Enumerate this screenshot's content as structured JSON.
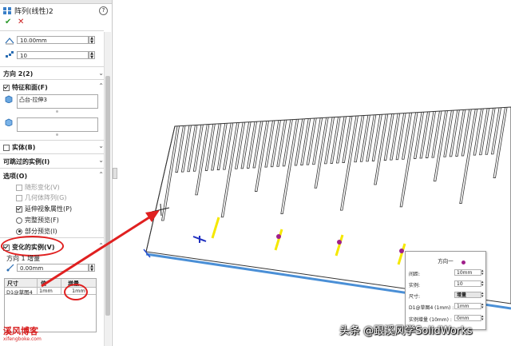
{
  "panel": {
    "title": "阵列(线性)2",
    "ok_symbol": "✔",
    "cancel_symbol": "✕",
    "help_symbol": "?",
    "spacing_value": "10.00mm",
    "instances_value": "10",
    "direction2_header": "方向 2(2)",
    "features_header": "特征和面(F)",
    "feature_item": "凸台-拉伸3",
    "bodies_header": "实体(B)",
    "skip_header": "可跳过的实例(I)",
    "options_header": "选项(O)",
    "opt_vary_sketch": "随形变化(V)",
    "opt_geometry_pattern": "几何体阵列(G)",
    "opt_propagate_visual": "延伸视象属性(P)",
    "opt_full_preview": "完整预览(F)",
    "opt_partial_preview": "部分预览(I)",
    "varying_header": "变化的实例(V)",
    "direction1_increment": "方向 1 增量",
    "increment_value": "0.00mm",
    "table": {
      "headers": [
        "尺寸",
        "值",
        "增量"
      ],
      "rows": [
        [
          "D1@草图4",
          "1mm",
          "1mm"
        ]
      ]
    }
  },
  "popup": {
    "title": "方向一",
    "rows": [
      {
        "label": "间距:",
        "value": "10mm"
      },
      {
        "label": "实例:",
        "value": "10"
      },
      {
        "label": "尺寸:",
        "value": "增量"
      },
      {
        "label": "D1@草图4 (1mm) :",
        "value": "1mm"
      },
      {
        "label": "实例增量 (10mm) :",
        "value": "0mm"
      }
    ]
  },
  "watermark": "头条 @跟溪风学SolidWorks",
  "logo": {
    "main": "溪风博客",
    "sub": "xifengboke.com"
  },
  "colors": {
    "accent_red": "#e02020",
    "yellow_arrow": "#f5e800",
    "magenta_dot": "#a0208a",
    "edge_blue": "#4a8fd6"
  }
}
